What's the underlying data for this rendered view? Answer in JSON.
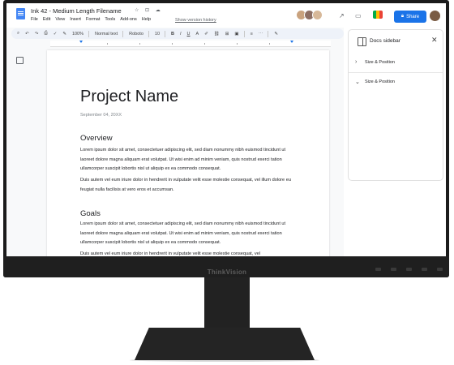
{
  "app": {
    "doc_title": "Ink 42 - Medium Length Filename",
    "title_icons": "☆ ⊡ ☁",
    "menus": [
      "File",
      "Edit",
      "View",
      "Insert",
      "Format",
      "Tools",
      "Add-ons",
      "Help"
    ],
    "version_history": "Show version history",
    "share_label": "Share",
    "avatar_colors": [
      "#c9a27e",
      "#8d6e63",
      "#d7b899"
    ]
  },
  "toolbar": {
    "zoom": "100%",
    "style": "Normal text",
    "font": "Roboto",
    "font_size": "10",
    "bold": "B",
    "italic": "I",
    "underline": "U",
    "text_color": "A"
  },
  "document": {
    "title": "Project Name",
    "date": "September 04, 20XX",
    "overview_heading": "Overview",
    "overview_p1": "Lorem ipsum dolor sit amet, consectetuer adipiscing elit, sed diam nonummy nibh euismod tincidunt ut laoreet dolore magna aliquam erat volutpat. Ut wisi enim ad minim veniam, quis nostrud exerci tation ullamcorper suscipit lobortis nisl ut aliquip ex ea commodo consequat.",
    "overview_p2": "Duis autem vel eum iriure dolor in hendrerit in vulputate velit esse molestie consequat, vel illum dolore eu feugiat nulla facilisis at vero eros et accumsan.",
    "goals_heading": "Goals",
    "goals_p1": "Lorem ipsum dolor sit amet, consectetuer adipiscing elit, sed diam nonummy nibh euismod tincidunt ut laoreet dolore magna aliquam erat volutpat. Ut wisi enim ad minim veniam, quis nostrud exerci tation ullamcorper suscipit lobortis nisl ut aliquip ex ea commodo consequat.",
    "goals_p2": "Duis autem vel eum iriure dolor in hendrerit in vulputate velit esse molestie consequat, vel"
  },
  "sidebar": {
    "title": "Docs sidebar",
    "close": "✕",
    "items": [
      {
        "label": "Size & Position",
        "chevron": "›"
      },
      {
        "label": "Size & Position",
        "chevron": "⌄"
      }
    ]
  },
  "monitor": {
    "brand": "ThinkVision"
  },
  "colors": {
    "accent": "#1a73e8",
    "bezel": "#1b1b1b",
    "toolbar_bg": "#eef2f9"
  }
}
